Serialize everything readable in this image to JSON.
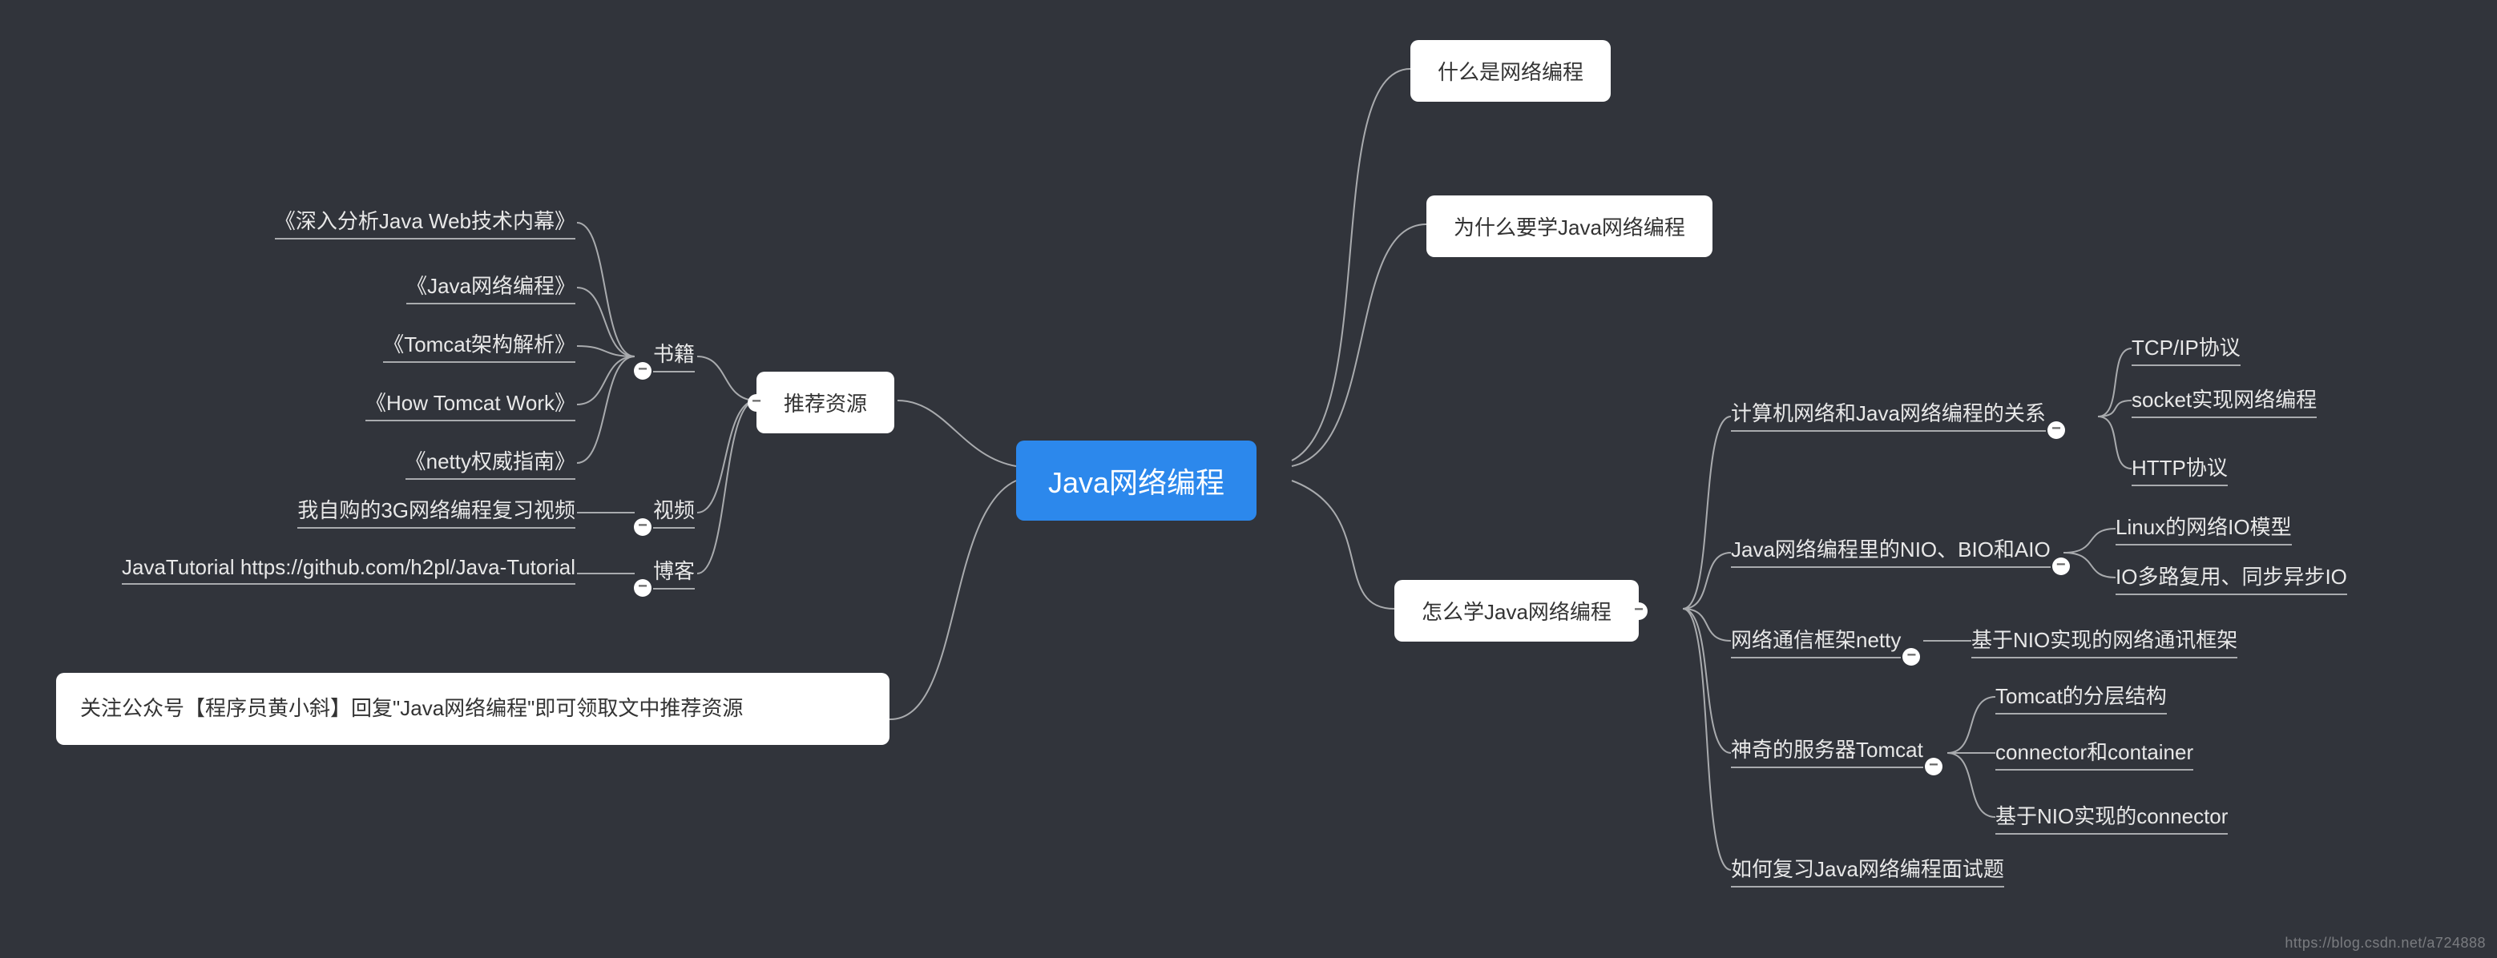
{
  "root": {
    "label": "Java网络编程"
  },
  "right": {
    "n1": {
      "label": "什么是网络编程"
    },
    "n2": {
      "label": "为什么要学Java网络编程"
    },
    "n3": {
      "label": "怎么学Java网络编程",
      "children": {
        "c1": {
          "label": "计算机网络和Java网络编程的关系",
          "leaves": {
            "l1": "TCP/IP协议",
            "l2": "socket实现网络编程",
            "l3": "HTTP协议"
          }
        },
        "c2": {
          "label": "Java网络编程里的NIO、BIO和AIO",
          "leaves": {
            "l1": "Linux的网络IO模型",
            "l2": "IO多路复用、同步异步IO"
          }
        },
        "c3": {
          "label": "网络通信框架netty",
          "leaves": {
            "l1": "基于NIO实现的网络通讯框架"
          }
        },
        "c4": {
          "label": "神奇的服务器Tomcat",
          "leaves": {
            "l1": "Tomcat的分层结构",
            "l2": "connector和container",
            "l3": "基于NIO实现的connector"
          }
        },
        "c5": {
          "label": "如何复习Java网络编程面试题"
        }
      }
    }
  },
  "left": {
    "n1": {
      "label": "推荐资源",
      "children": {
        "c1": {
          "label": "书籍",
          "leaves": {
            "l1": "《深入分析Java  Web技术内幕》",
            "l2": "《Java网络编程》",
            "l3": "《Tomcat架构解析》",
            "l4": "《How Tomcat Work》",
            "l5": "《netty权威指南》"
          }
        },
        "c2": {
          "label": "视频",
          "leaves": {
            "l1": "我自购的3G网络编程复习视频"
          }
        },
        "c3": {
          "label": "博客",
          "leaves": {
            "l1": "JavaTutorial https://github.com/h2pl/Java-Tutorial"
          }
        }
      }
    },
    "note": "关注公众号【程序员黄小斜】回复\"Java网络编程\"即可领取文中推荐资源"
  },
  "watermark": "https://blog.csdn.net/a724888"
}
